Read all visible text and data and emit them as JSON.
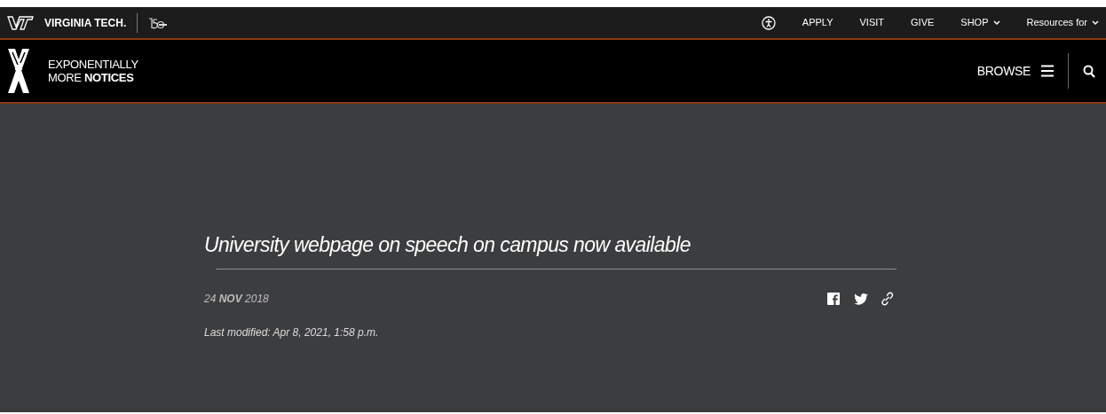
{
  "top_bar": {
    "brand": "VIRGINIA TECH.",
    "links": [
      {
        "label": "APPLY",
        "dropdown": false
      },
      {
        "label": "VISIT",
        "dropdown": false
      },
      {
        "label": "GIVE",
        "dropdown": false
      },
      {
        "label": "SHOP",
        "dropdown": true
      },
      {
        "label": "Resources for",
        "dropdown": true
      }
    ]
  },
  "site_header": {
    "title_lines": [
      "EXPONENTIALLY",
      "MORE **NOTICES**"
    ],
    "browse": "BROWSE"
  },
  "article": {
    "title": "University webpage on speech on campus now available",
    "date": "24 **NOV** 2018",
    "last_modified": "Last modified: Apr 8, 2021, 1:58 p.m."
  }
}
